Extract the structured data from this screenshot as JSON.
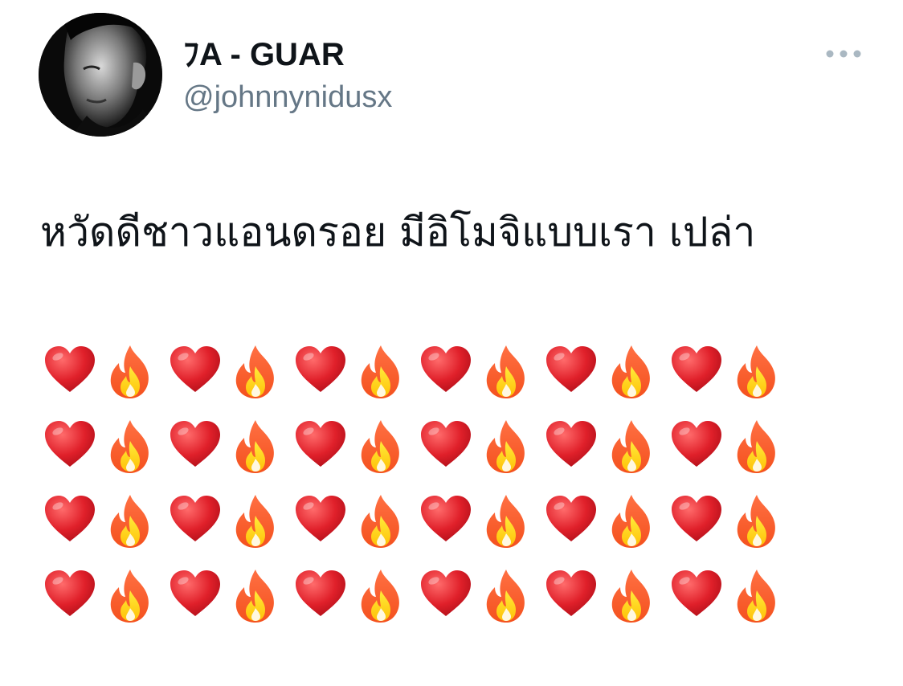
{
  "tweet": {
    "author": {
      "display_name": "ﾌA - GUAR",
      "handle": "@johnnynidusx",
      "avatar": "profile-photo-icon"
    },
    "more_icon": "more-options-icon",
    "text": "หวัดดีชาวแอนดรอย มีอิโมจิแบบเรา เปล่า",
    "emoji_rows": [
      [
        "red-heart",
        "fire",
        "red-heart",
        "fire",
        "red-heart",
        "fire",
        "red-heart",
        "fire",
        "red-heart",
        "fire",
        "red-heart",
        "fire"
      ],
      [
        "red-heart",
        "fire",
        "red-heart",
        "fire",
        "red-heart",
        "fire",
        "red-heart",
        "fire",
        "red-heart",
        "fire",
        "red-heart",
        "fire"
      ],
      [
        "red-heart",
        "fire",
        "red-heart",
        "fire",
        "red-heart",
        "fire",
        "red-heart",
        "fire",
        "red-heart",
        "fire",
        "red-heart",
        "fire"
      ],
      [
        "red-heart",
        "fire",
        "red-heart",
        "fire",
        "red-heart",
        "fire",
        "red-heart",
        "fire",
        "red-heart",
        "fire",
        "red-heart",
        "fire"
      ]
    ]
  },
  "colors": {
    "text": "#0f1419",
    "secondary_text": "#657786",
    "more_dots": "#aab8c2",
    "heart": "#e0202a",
    "fire_outer": "#f4511e",
    "fire_inner": "#ffc107"
  }
}
